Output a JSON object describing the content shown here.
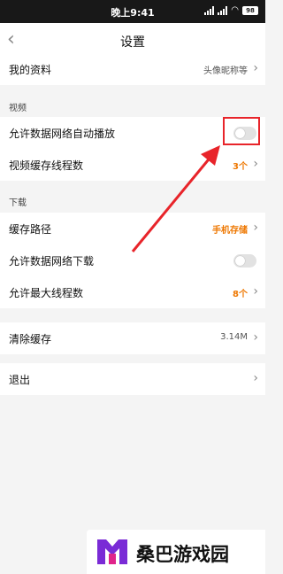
{
  "status_bar": {
    "time": "晚上9:41",
    "battery": "98"
  },
  "nav": {
    "title": "设置"
  },
  "profile": {
    "label": "我的资料",
    "value": "头像昵称等"
  },
  "sections": {
    "video": "视频",
    "download": "下载"
  },
  "video": {
    "autoplay_label": "允许数据网络自动播放",
    "autoplay_on": false,
    "cache_threads_label": "视频缓存线程数",
    "cache_threads_value": "3个"
  },
  "download": {
    "cache_path_label": "缓存路径",
    "cache_path_value": "手机存储",
    "mobile_download_label": "允许数据网络下载",
    "mobile_download_on": false,
    "max_threads_label": "允许最大线程数",
    "max_threads_value": "8个"
  },
  "cache": {
    "label": "清除缓存",
    "value": "3.14M"
  },
  "logout": {
    "label": "退出"
  },
  "watermark": {
    "text": "桑巴游戏园"
  },
  "colors": {
    "accent": "#ee7700",
    "annotation": "#e8242a"
  }
}
